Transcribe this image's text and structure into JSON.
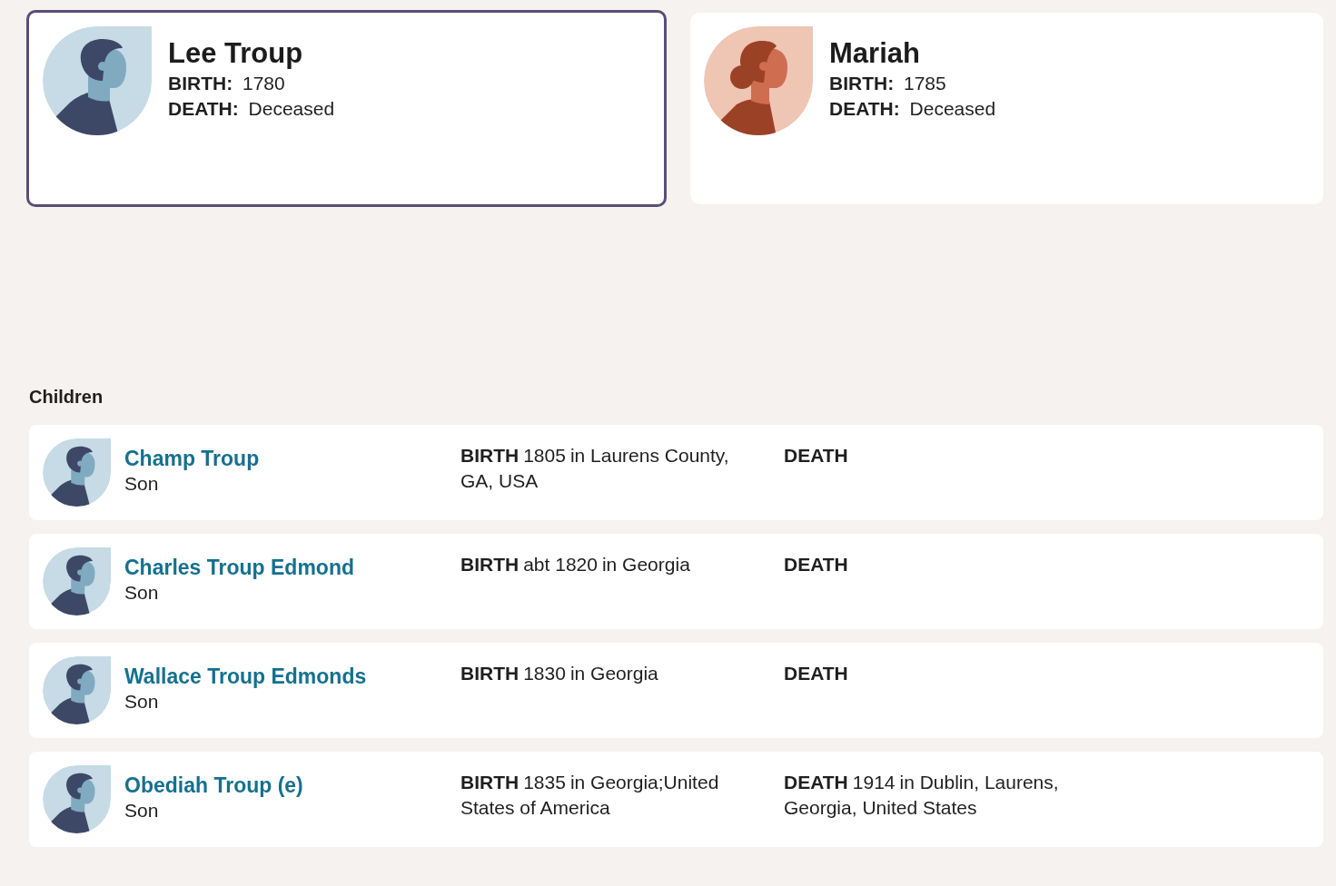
{
  "parents": [
    {
      "name": "Lee Troup",
      "kind": "male",
      "selected": true,
      "birth": {
        "label": "BIRTH:",
        "value": "1780"
      },
      "death": {
        "label": "DEATH:",
        "value": "Deceased"
      }
    },
    {
      "name": "Mariah",
      "kind": "female",
      "selected": false,
      "birth": {
        "label": "BIRTH:",
        "value": "1785"
      },
      "death": {
        "label": "DEATH:",
        "value": "Deceased"
      }
    }
  ],
  "children_section": {
    "title": "Children",
    "children": [
      {
        "name": "Champ Troup",
        "relation": "Son",
        "kind": "male",
        "birth": {
          "label": "BIRTH",
          "date": "1805",
          "place": "in Laurens County, GA, USA"
        },
        "death": {
          "label": "DEATH"
        }
      },
      {
        "name": "Charles Troup Edmond",
        "relation": "Son",
        "kind": "male",
        "birth": {
          "label": "BIRTH",
          "date": "abt 1820",
          "place": "in Georgia"
        },
        "death": {
          "label": "DEATH"
        }
      },
      {
        "name": "Wallace Troup Edmonds",
        "relation": "Son",
        "kind": "male",
        "birth": {
          "label": "BIRTH",
          "date": "1830",
          "place": "in Georgia"
        },
        "death": {
          "label": "DEATH"
        }
      },
      {
        "name": "Obediah Troup (e)",
        "relation": "Son",
        "kind": "male",
        "birth": {
          "label": "BIRTH",
          "date": "1835",
          "place": "in Georgia;United States of America"
        },
        "death": {
          "label": "DEATH",
          "date": "1914",
          "place": "in Dublin, Laurens, Georgia, United States"
        }
      }
    ]
  }
}
